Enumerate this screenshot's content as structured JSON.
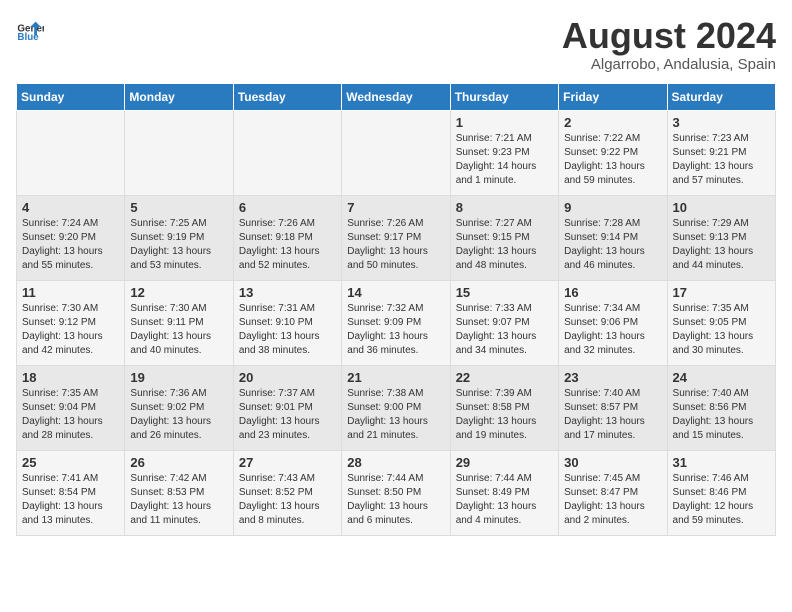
{
  "header": {
    "logo_general": "General",
    "logo_blue": "Blue",
    "month_year": "August 2024",
    "location": "Algarrobo, Andalusia, Spain"
  },
  "weekdays": [
    "Sunday",
    "Monday",
    "Tuesday",
    "Wednesday",
    "Thursday",
    "Friday",
    "Saturday"
  ],
  "weeks": [
    [
      {
        "day": "",
        "info": ""
      },
      {
        "day": "",
        "info": ""
      },
      {
        "day": "",
        "info": ""
      },
      {
        "day": "",
        "info": ""
      },
      {
        "day": "1",
        "info": "Sunrise: 7:21 AM\nSunset: 9:23 PM\nDaylight: 14 hours\nand 1 minute."
      },
      {
        "day": "2",
        "info": "Sunrise: 7:22 AM\nSunset: 9:22 PM\nDaylight: 13 hours\nand 59 minutes."
      },
      {
        "day": "3",
        "info": "Sunrise: 7:23 AM\nSunset: 9:21 PM\nDaylight: 13 hours\nand 57 minutes."
      }
    ],
    [
      {
        "day": "4",
        "info": "Sunrise: 7:24 AM\nSunset: 9:20 PM\nDaylight: 13 hours\nand 55 minutes."
      },
      {
        "day": "5",
        "info": "Sunrise: 7:25 AM\nSunset: 9:19 PM\nDaylight: 13 hours\nand 53 minutes."
      },
      {
        "day": "6",
        "info": "Sunrise: 7:26 AM\nSunset: 9:18 PM\nDaylight: 13 hours\nand 52 minutes."
      },
      {
        "day": "7",
        "info": "Sunrise: 7:26 AM\nSunset: 9:17 PM\nDaylight: 13 hours\nand 50 minutes."
      },
      {
        "day": "8",
        "info": "Sunrise: 7:27 AM\nSunset: 9:15 PM\nDaylight: 13 hours\nand 48 minutes."
      },
      {
        "day": "9",
        "info": "Sunrise: 7:28 AM\nSunset: 9:14 PM\nDaylight: 13 hours\nand 46 minutes."
      },
      {
        "day": "10",
        "info": "Sunrise: 7:29 AM\nSunset: 9:13 PM\nDaylight: 13 hours\nand 44 minutes."
      }
    ],
    [
      {
        "day": "11",
        "info": "Sunrise: 7:30 AM\nSunset: 9:12 PM\nDaylight: 13 hours\nand 42 minutes."
      },
      {
        "day": "12",
        "info": "Sunrise: 7:30 AM\nSunset: 9:11 PM\nDaylight: 13 hours\nand 40 minutes."
      },
      {
        "day": "13",
        "info": "Sunrise: 7:31 AM\nSunset: 9:10 PM\nDaylight: 13 hours\nand 38 minutes."
      },
      {
        "day": "14",
        "info": "Sunrise: 7:32 AM\nSunset: 9:09 PM\nDaylight: 13 hours\nand 36 minutes."
      },
      {
        "day": "15",
        "info": "Sunrise: 7:33 AM\nSunset: 9:07 PM\nDaylight: 13 hours\nand 34 minutes."
      },
      {
        "day": "16",
        "info": "Sunrise: 7:34 AM\nSunset: 9:06 PM\nDaylight: 13 hours\nand 32 minutes."
      },
      {
        "day": "17",
        "info": "Sunrise: 7:35 AM\nSunset: 9:05 PM\nDaylight: 13 hours\nand 30 minutes."
      }
    ],
    [
      {
        "day": "18",
        "info": "Sunrise: 7:35 AM\nSunset: 9:04 PM\nDaylight: 13 hours\nand 28 minutes."
      },
      {
        "day": "19",
        "info": "Sunrise: 7:36 AM\nSunset: 9:02 PM\nDaylight: 13 hours\nand 26 minutes."
      },
      {
        "day": "20",
        "info": "Sunrise: 7:37 AM\nSunset: 9:01 PM\nDaylight: 13 hours\nand 23 minutes."
      },
      {
        "day": "21",
        "info": "Sunrise: 7:38 AM\nSunset: 9:00 PM\nDaylight: 13 hours\nand 21 minutes."
      },
      {
        "day": "22",
        "info": "Sunrise: 7:39 AM\nSunset: 8:58 PM\nDaylight: 13 hours\nand 19 minutes."
      },
      {
        "day": "23",
        "info": "Sunrise: 7:40 AM\nSunset: 8:57 PM\nDaylight: 13 hours\nand 17 minutes."
      },
      {
        "day": "24",
        "info": "Sunrise: 7:40 AM\nSunset: 8:56 PM\nDaylight: 13 hours\nand 15 minutes."
      }
    ],
    [
      {
        "day": "25",
        "info": "Sunrise: 7:41 AM\nSunset: 8:54 PM\nDaylight: 13 hours\nand 13 minutes."
      },
      {
        "day": "26",
        "info": "Sunrise: 7:42 AM\nSunset: 8:53 PM\nDaylight: 13 hours\nand 11 minutes."
      },
      {
        "day": "27",
        "info": "Sunrise: 7:43 AM\nSunset: 8:52 PM\nDaylight: 13 hours\nand 8 minutes."
      },
      {
        "day": "28",
        "info": "Sunrise: 7:44 AM\nSunset: 8:50 PM\nDaylight: 13 hours\nand 6 minutes."
      },
      {
        "day": "29",
        "info": "Sunrise: 7:44 AM\nSunset: 8:49 PM\nDaylight: 13 hours\nand 4 minutes."
      },
      {
        "day": "30",
        "info": "Sunrise: 7:45 AM\nSunset: 8:47 PM\nDaylight: 13 hours\nand 2 minutes."
      },
      {
        "day": "31",
        "info": "Sunrise: 7:46 AM\nSunset: 8:46 PM\nDaylight: 12 hours\nand 59 minutes."
      }
    ]
  ]
}
